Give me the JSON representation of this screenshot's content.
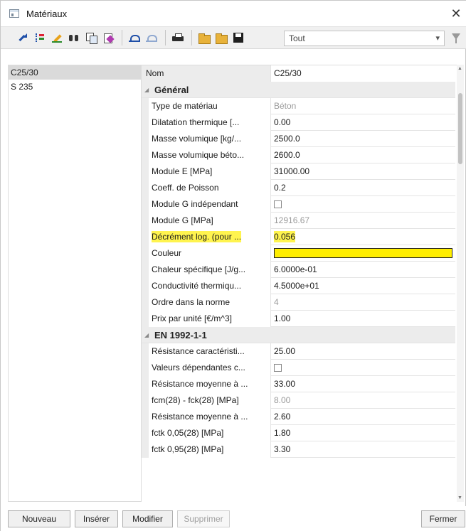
{
  "window": {
    "title": "Matériaux",
    "close_glyph": "✕"
  },
  "toolbar": {
    "icons": [
      "arrow-icon",
      "tree-icon",
      "pencil-icon",
      "binoculars-icon",
      "copy-icon",
      "clear-icon",
      "undo-icon",
      "redo-icon",
      "print-icon",
      "open-folder-icon",
      "open-folder-2-icon",
      "save-icon",
      "filter-icon"
    ],
    "filter_value": "Tout",
    "combo_arrow": "▾"
  },
  "materials_list": [
    "C25/30",
    "S 235"
  ],
  "grid": {
    "header": {
      "name": "Nom",
      "value": "C25/30"
    },
    "sections": [
      {
        "title": "Général",
        "rows": [
          {
            "name": "Type de matériau",
            "value": "Béton",
            "muted": true
          },
          {
            "name": "Dilatation thermique  [...",
            "value": "0.00"
          },
          {
            "name": "Masse volumique [kg/...",
            "value": "2500.0"
          },
          {
            "name": "Masse volumique béto...",
            "value": "2600.0"
          },
          {
            "name": "Module E [MPa]",
            "value": "31000.00"
          },
          {
            "name": "Coeff. de Poisson",
            "value": "0.2"
          },
          {
            "name": "Module G indépendant",
            "checkbox": true
          },
          {
            "name": "Module G [MPa]",
            "value": "12916.67",
            "muted": true
          },
          {
            "name": "Décrément log. (pour ...",
            "value": "0.056",
            "highlight": true
          },
          {
            "name": "Couleur",
            "swatch": "#ffee00"
          },
          {
            "name": "Chaleur spécifique [J/g...",
            "value": "6.0000e-01"
          },
          {
            "name": "Conductivité thermiqu...",
            "value": "4.5000e+01"
          },
          {
            "name": "Ordre dans la norme",
            "value": "4",
            "muted": true
          },
          {
            "name": "Prix par unité [€/m^3]",
            "value": "1.00"
          }
        ]
      },
      {
        "title": "EN 1992-1-1",
        "rows": [
          {
            "name": "Résistance caractéristi...",
            "value": "25.00"
          },
          {
            "name": "Valeurs dépendantes c...",
            "checkbox": true
          },
          {
            "name": "Résistance moyenne à ...",
            "value": "33.00"
          },
          {
            "name": "fcm(28) - fck(28) [MPa]",
            "value": "8.00",
            "muted": true
          },
          {
            "name": "Résistance moyenne à ...",
            "value": "2.60"
          },
          {
            "name": "fctk 0,05(28) [MPa]",
            "value": "1.80"
          },
          {
            "name": "fctk 0,95(28) [MPa]",
            "value": "3.30"
          }
        ]
      }
    ],
    "toggle_glyph": "◢"
  },
  "buttons": {
    "nouveau": "Nouveau",
    "inserer": "Insérer",
    "modifier": "Modifier",
    "supprimer": "Supprimer",
    "fermer": "Fermer"
  },
  "colors": {
    "highlight": "#fff44f",
    "swatch": "#ffee00"
  }
}
